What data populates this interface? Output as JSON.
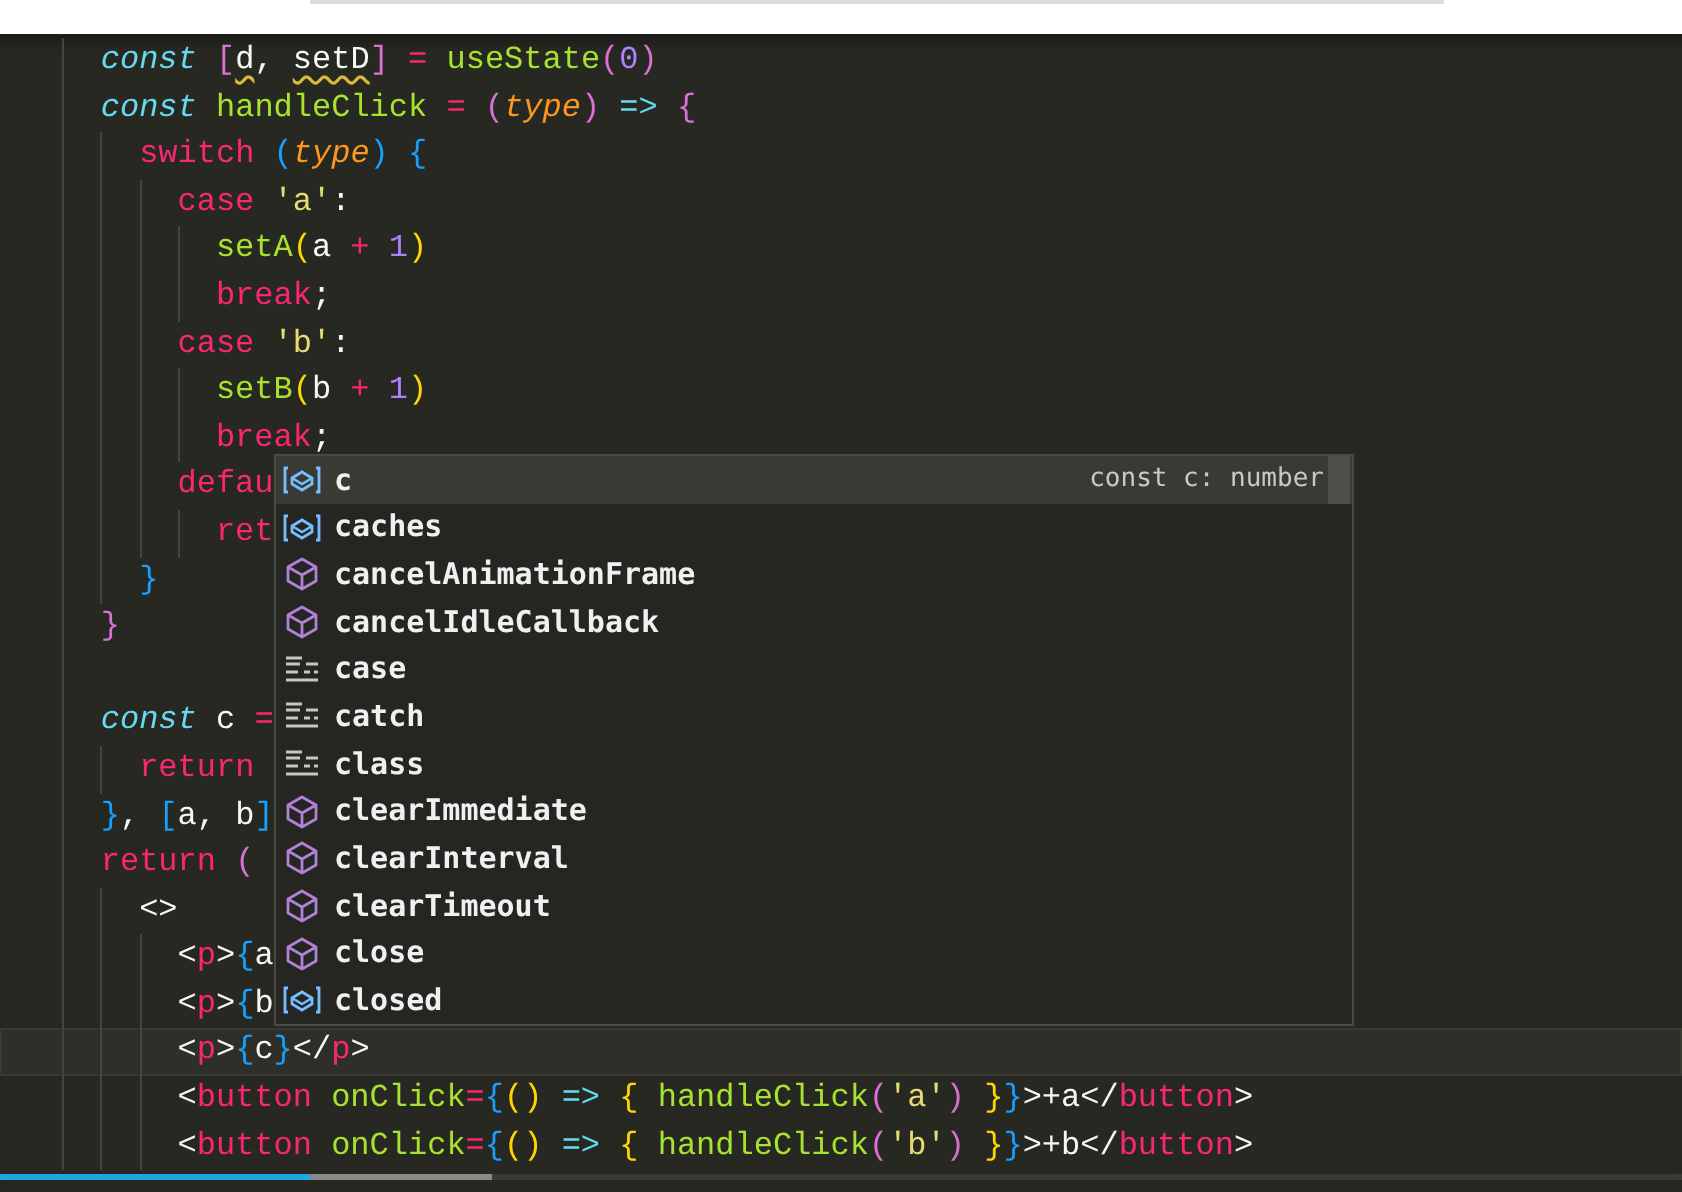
{
  "editor": {
    "lines": [
      {
        "tokens": [
          {
            "text": "const ",
            "kind": "storage"
          },
          {
            "text": "[",
            "kind": "b2"
          },
          {
            "text": "d",
            "kind": "ident",
            "warning": true
          },
          {
            "text": ", ",
            "kind": "ident"
          },
          {
            "text": "setD",
            "kind": "ident",
            "warning": true
          },
          {
            "text": "]",
            "kind": "b2"
          },
          {
            "text": " = ",
            "kind": "op"
          },
          {
            "text": "useState",
            "kind": "func"
          },
          {
            "text": "(",
            "kind": "b2"
          },
          {
            "text": "0",
            "kind": "num"
          },
          {
            "text": ")",
            "kind": "b2"
          }
        ]
      },
      {
        "tokens": [
          {
            "text": "const ",
            "kind": "storage"
          },
          {
            "text": "handleClick",
            "kind": "func"
          },
          {
            "text": " = ",
            "kind": "op"
          },
          {
            "text": "(",
            "kind": "b2"
          },
          {
            "text": "type",
            "kind": "param"
          },
          {
            "text": ")",
            "kind": "b2"
          },
          {
            "text": " => ",
            "kind": "arrow"
          },
          {
            "text": "{",
            "kind": "b2"
          }
        ],
        "children": [
          {
            "tokens": [
              {
                "text": "switch ",
                "kind": "kw"
              },
              {
                "text": "(",
                "kind": "b3"
              },
              {
                "text": "type",
                "kind": "param"
              },
              {
                "text": ")",
                "kind": "b3"
              },
              {
                "text": " {",
                "kind": "b3"
              }
            ],
            "children": [
              {
                "tokens": [
                  {
                    "text": "case ",
                    "kind": "kw"
                  },
                  {
                    "text": "'a'",
                    "kind": "str"
                  },
                  {
                    "text": ":",
                    "kind": "ident"
                  }
                ],
                "children": [
                  {
                    "tokens": [
                      {
                        "text": "setA",
                        "kind": "func"
                      },
                      {
                        "text": "(",
                        "kind": "b1"
                      },
                      {
                        "text": "a ",
                        "kind": "ident"
                      },
                      {
                        "text": "+ ",
                        "kind": "op"
                      },
                      {
                        "text": "1",
                        "kind": "num"
                      },
                      {
                        "text": ")",
                        "kind": "b1"
                      }
                    ]
                  },
                  {
                    "tokens": [
                      {
                        "text": "break",
                        "kind": "kw"
                      },
                      {
                        "text": ";",
                        "kind": "ident"
                      }
                    ]
                  }
                ]
              },
              {
                "tokens": [
                  {
                    "text": "case ",
                    "kind": "kw"
                  },
                  {
                    "text": "'b'",
                    "kind": "str"
                  },
                  {
                    "text": ":",
                    "kind": "ident"
                  }
                ],
                "children": [
                  {
                    "tokens": [
                      {
                        "text": "setB",
                        "kind": "func"
                      },
                      {
                        "text": "(",
                        "kind": "b1"
                      },
                      {
                        "text": "b ",
                        "kind": "ident"
                      },
                      {
                        "text": "+ ",
                        "kind": "op"
                      },
                      {
                        "text": "1",
                        "kind": "num"
                      },
                      {
                        "text": ")",
                        "kind": "b1"
                      }
                    ]
                  },
                  {
                    "tokens": [
                      {
                        "text": "break",
                        "kind": "kw"
                      },
                      {
                        "text": ";",
                        "kind": "ident"
                      }
                    ]
                  }
                ]
              },
              {
                "tokens": [
                  {
                    "text": "defau",
                    "kind": "kw"
                  }
                ],
                "children": [
                  {
                    "tokens": [
                      {
                        "text": "ret",
                        "kind": "kw"
                      }
                    ]
                  }
                ]
              }
            ]
          },
          {
            "tokens": [
              {
                "text": "}",
                "kind": "b3"
              }
            ]
          }
        ]
      },
      {
        "tokens": [
          {
            "text": "}",
            "kind": "b2"
          }
        ]
      },
      {
        "blank_before": true,
        "tokens": [
          {
            "text": "const ",
            "kind": "storage"
          },
          {
            "text": "c ",
            "kind": "ident"
          },
          {
            "text": "=",
            "kind": "op"
          }
        ],
        "children": [
          {
            "tokens": [
              {
                "text": "return",
                "kind": "kw"
              }
            ]
          }
        ]
      },
      {
        "tokens": [
          {
            "text": "}",
            "kind": "b3"
          },
          {
            "text": ", ",
            "kind": "ident"
          },
          {
            "text": "[",
            "kind": "b3"
          },
          {
            "text": "a, b",
            "kind": "ident"
          },
          {
            "text": "]",
            "kind": "b3"
          }
        ]
      },
      {
        "tokens": [
          {
            "text": "return ",
            "kind": "kw"
          },
          {
            "text": "(",
            "kind": "b2"
          }
        ],
        "children": [
          {
            "tokens": [
              {
                "text": "<>",
                "kind": "ident"
              }
            ],
            "children": [
              {
                "tokens": [
                  {
                    "text": "<",
                    "kind": "ident"
                  },
                  {
                    "text": "p",
                    "kind": "kw"
                  },
                  {
                    "text": ">",
                    "kind": "ident"
                  },
                  {
                    "text": "{",
                    "kind": "b3"
                  },
                  {
                    "text": "a",
                    "kind": "ident"
                  }
                ]
              },
              {
                "tokens": [
                  {
                    "text": "<",
                    "kind": "ident"
                  },
                  {
                    "text": "p",
                    "kind": "kw"
                  },
                  {
                    "text": ">",
                    "kind": "ident"
                  },
                  {
                    "text": "{",
                    "kind": "b3"
                  },
                  {
                    "text": "b",
                    "kind": "ident"
                  }
                ]
              },
              {
                "current": true,
                "tokens": [
                  {
                    "text": "<",
                    "kind": "ident"
                  },
                  {
                    "text": "p",
                    "kind": "kw"
                  },
                  {
                    "text": ">",
                    "kind": "ident"
                  },
                  {
                    "text": "{",
                    "kind": "b3"
                  },
                  {
                    "text": "c",
                    "kind": "ident"
                  },
                  {
                    "text": "}",
                    "kind": "b3"
                  },
                  {
                    "text": "</",
                    "kind": "ident"
                  },
                  {
                    "text": "p",
                    "kind": "kw"
                  },
                  {
                    "text": ">",
                    "kind": "ident"
                  }
                ]
              },
              {
                "tokens": [
                  {
                    "text": "<",
                    "kind": "ident"
                  },
                  {
                    "text": "button ",
                    "kind": "kw"
                  },
                  {
                    "text": "onClick",
                    "kind": "func"
                  },
                  {
                    "text": "=",
                    "kind": "op"
                  },
                  {
                    "text": "{",
                    "kind": "b3"
                  },
                  {
                    "text": "() ",
                    "kind": "b1"
                  },
                  {
                    "text": "=> ",
                    "kind": "arrow"
                  },
                  {
                    "text": "{ ",
                    "kind": "b1"
                  },
                  {
                    "text": "handleClick",
                    "kind": "func"
                  },
                  {
                    "text": "(",
                    "kind": "b2"
                  },
                  {
                    "text": "'a'",
                    "kind": "str"
                  },
                  {
                    "text": ") ",
                    "kind": "b2"
                  },
                  {
                    "text": "}",
                    "kind": "b1"
                  },
                  {
                    "text": "}",
                    "kind": "b3"
                  },
                  {
                    "text": ">+a</",
                    "kind": "ident"
                  },
                  {
                    "text": "button",
                    "kind": "kw"
                  },
                  {
                    "text": ">",
                    "kind": "ident"
                  }
                ]
              },
              {
                "tokens": [
                  {
                    "text": "<",
                    "kind": "ident"
                  },
                  {
                    "text": "button ",
                    "kind": "kw"
                  },
                  {
                    "text": "onClick",
                    "kind": "func"
                  },
                  {
                    "text": "=",
                    "kind": "op"
                  },
                  {
                    "text": "{",
                    "kind": "b3"
                  },
                  {
                    "text": "() ",
                    "kind": "b1"
                  },
                  {
                    "text": "=> ",
                    "kind": "arrow"
                  },
                  {
                    "text": "{ ",
                    "kind": "b1"
                  },
                  {
                    "text": "handleClick",
                    "kind": "func"
                  },
                  {
                    "text": "(",
                    "kind": "b2"
                  },
                  {
                    "text": "'b'",
                    "kind": "str"
                  },
                  {
                    "text": ") ",
                    "kind": "b2"
                  },
                  {
                    "text": "}",
                    "kind": "b1"
                  },
                  {
                    "text": "}",
                    "kind": "b3"
                  },
                  {
                    "text": ">+b</",
                    "kind": "ident"
                  },
                  {
                    "text": "button",
                    "kind": "kw"
                  },
                  {
                    "text": ">",
                    "kind": "ident"
                  }
                ]
              }
            ]
          }
        ]
      }
    ]
  },
  "suggestions": [
    {
      "label": "c",
      "kind": "variable",
      "selected": true,
      "detail": "const c: number"
    },
    {
      "label": "caches",
      "kind": "variable",
      "selected": false
    },
    {
      "label": "cancelAnimationFrame",
      "kind": "method",
      "selected": false
    },
    {
      "label": "cancelIdleCallback",
      "kind": "method",
      "selected": false
    },
    {
      "label": "case",
      "kind": "keyword",
      "selected": false
    },
    {
      "label": "catch",
      "kind": "keyword",
      "selected": false
    },
    {
      "label": "class",
      "kind": "keyword",
      "selected": false
    },
    {
      "label": "clearImmediate",
      "kind": "method",
      "selected": false
    },
    {
      "label": "clearInterval",
      "kind": "method",
      "selected": false
    },
    {
      "label": "clearTimeout",
      "kind": "method",
      "selected": false
    },
    {
      "label": "close",
      "kind": "method",
      "selected": false
    },
    {
      "label": "closed",
      "kind": "variable",
      "selected": false
    }
  ],
  "video_progress": {
    "level": 0.184
  }
}
